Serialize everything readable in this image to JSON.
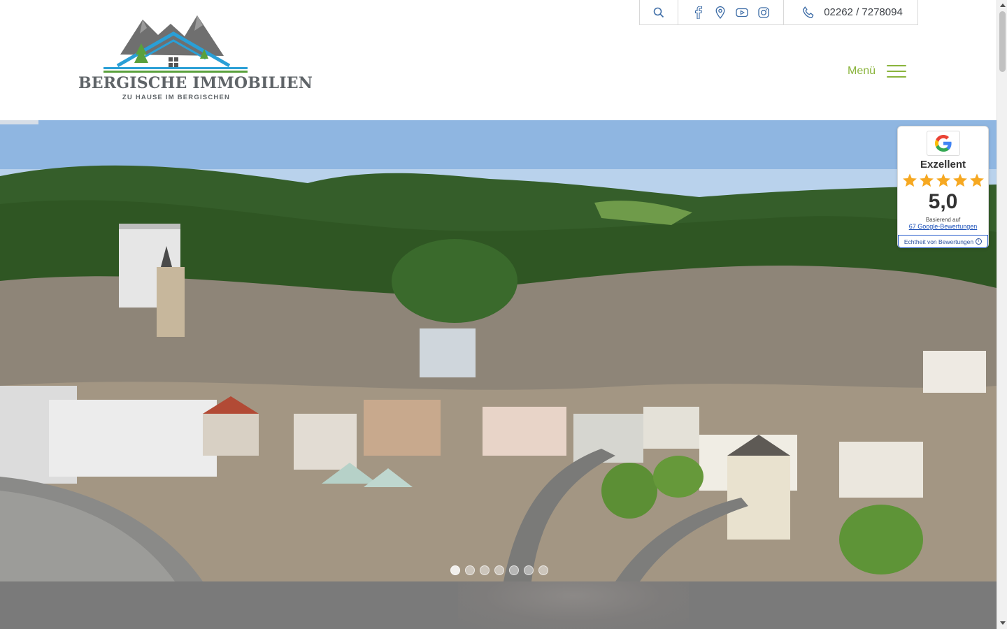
{
  "brand": {
    "title": "BERGISCHE IMMOBILIEN",
    "tagline": "ZU HAUSE IM BERGISCHEN",
    "colors": {
      "roof": "#2a9fd6",
      "mountains": "#6f6f6f",
      "tree": "#5aa03c",
      "text": "#5f6468"
    }
  },
  "topbar": {
    "search_icon": "search-icon",
    "social": [
      "facebook-icon",
      "map-pin-icon",
      "youtube-icon",
      "instagram-icon"
    ],
    "phone_icon": "phone-icon",
    "phone": "02262 / 7278094"
  },
  "nav": {
    "menu_label": "Menü",
    "accent": "#8ab43c"
  },
  "hero": {
    "slides_count": 7,
    "active_slide": 1
  },
  "reviews": {
    "rating_word": "Exzellent",
    "score": "5,0",
    "stars": 5,
    "based_on": "Basierend auf",
    "count_label": "67 Google-Bewertungen",
    "verify_label": "Echtheit von Bewertungen",
    "star_color": "#f6a821"
  }
}
